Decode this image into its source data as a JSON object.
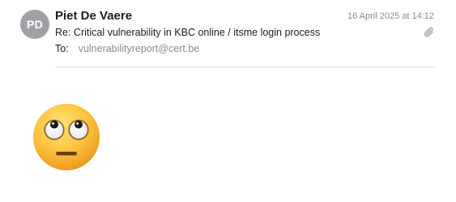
{
  "message": {
    "avatar_initials": "PD",
    "sender_name": "Piet De Vaere",
    "date": "16 April 2025 at 14:12",
    "subject": "Re: Critical vulnerability in KBC online / itsme login process",
    "to_label": "To:",
    "to_address": "vulnerabilityreport@cert.be",
    "has_attachment": true,
    "attachment_icon": "paperclip-icon"
  },
  "body": {
    "emoji": "face-with-rolling-eyes",
    "emoji_icon": "face-with-rolling-eyes-icon"
  },
  "colors": {
    "avatar_bg": "#a0a0a6",
    "muted_text": "#8a8a8e",
    "divider": "#e2e2e4",
    "emoji_face": "#fbbf3a"
  }
}
